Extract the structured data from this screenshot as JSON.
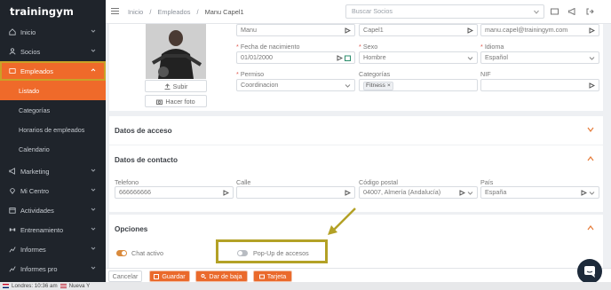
{
  "brand": "trainingym",
  "sidebar": {
    "items": [
      {
        "label": "Inicio"
      },
      {
        "label": "Socios"
      },
      {
        "label": "Empleados"
      },
      {
        "label": "Marketing"
      },
      {
        "label": "Mi Centro"
      },
      {
        "label": "Actividades"
      },
      {
        "label": "Entrenamiento"
      },
      {
        "label": "Informes"
      },
      {
        "label": "Informes pro"
      }
    ],
    "subitems": [
      {
        "label": "Listado"
      },
      {
        "label": "Categorías"
      },
      {
        "label": "Horarios de empleados"
      },
      {
        "label": "Calendario"
      }
    ]
  },
  "topbar": {
    "breadcrumb": [
      "Inicio",
      "/",
      "Empleados",
      "/",
      "Manu Capel1"
    ],
    "search_placeholder": "Buscar Socios"
  },
  "profile": {
    "upload_label": "Subir",
    "photo_label": "Hacer foto",
    "first_name": "Manu",
    "last_name": "Capel1",
    "email": "manu.capel@trainingym.com",
    "birth_label": "Fecha de nacimiento",
    "birth_value": "01/01/2000",
    "sex_label": "Sexo",
    "sex_value": "Hombre",
    "lang_label": "Idioma",
    "lang_value": "Español",
    "perm_label": "Permiso",
    "perm_value": "Coordinacion",
    "cat_label": "Categorías",
    "cat_value": "Fitness",
    "cat_remove": "×",
    "nif_label": "NIF",
    "nif_value": ""
  },
  "access": {
    "title": "Datos de acceso"
  },
  "contact": {
    "title": "Datos de contacto",
    "phone_label": "Telefono",
    "phone_value": "666666666",
    "street_label": "Calle",
    "street_value": "",
    "zip_label": "Código postal",
    "zip_value": "04007, Almería (Andalucía)",
    "country_label": "País",
    "country_value": "España"
  },
  "options": {
    "title": "Opciones",
    "chat_label": "Chat activo",
    "chat_on": true,
    "popup_label": "Pop-Up de accesos",
    "popup_on": false
  },
  "actions": {
    "cancel": "Cancelar",
    "save": "Guardar",
    "unsubscribe": "Dar de baja",
    "card": "Tarjeta"
  },
  "taskbar": {
    "clock1": "Londres: 10:36 am",
    "clock2": "Nueva Y"
  },
  "colors": {
    "accent": "#ef6a2a",
    "sidebar_bg": "#1f242b",
    "highlight": "#b3a126"
  }
}
